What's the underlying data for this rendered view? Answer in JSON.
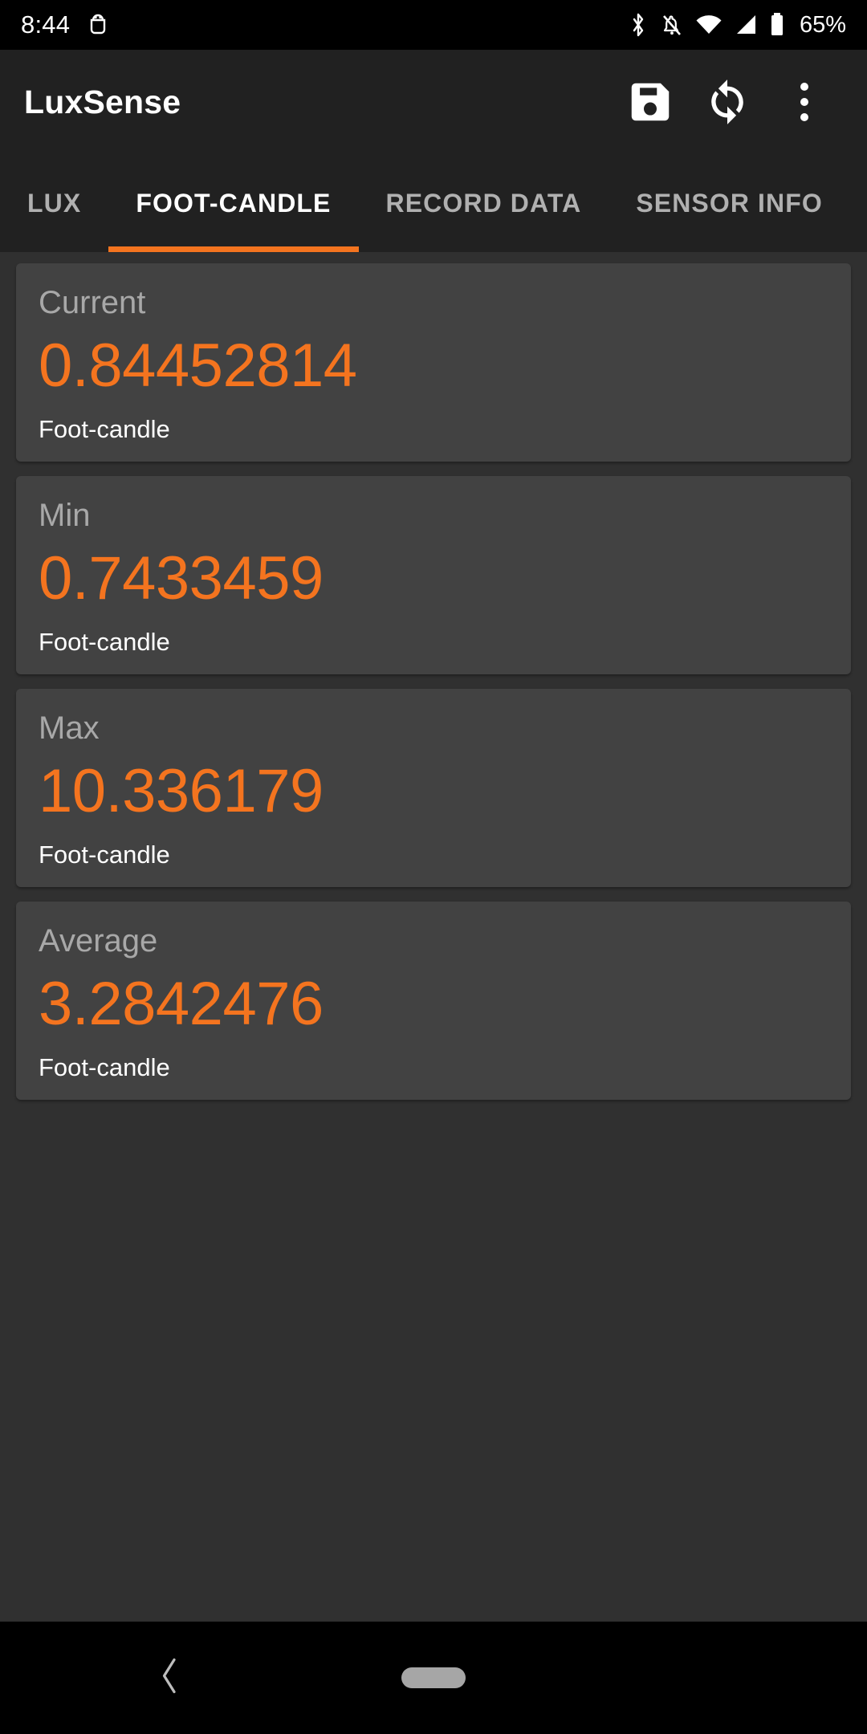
{
  "status_bar": {
    "time": "8:44",
    "battery_percent": "65%",
    "icons": [
      "android-debug-icon",
      "bluetooth-icon",
      "notifications-muted-icon",
      "wifi-icon",
      "cellular-signal-icon",
      "battery-icon"
    ],
    "colors": {
      "background": "#000000",
      "foreground": "#ffffff"
    }
  },
  "app_bar": {
    "title": "LuxSense",
    "actions": [
      {
        "name": "save-button",
        "icon": "save-icon"
      },
      {
        "name": "reset-button",
        "icon": "refresh-icon"
      },
      {
        "name": "overflow-menu-button",
        "icon": "more-vertical-icon"
      }
    ],
    "colors": {
      "background": "#212121",
      "title": "#ffffff"
    }
  },
  "tabs": {
    "items": [
      {
        "label": "LUX",
        "active": false
      },
      {
        "label": "FOOT-CANDLE",
        "active": true
      },
      {
        "label": "RECORD DATA",
        "active": false
      },
      {
        "label": "SENSOR INFO",
        "active": false
      }
    ],
    "active_index": 1,
    "colors": {
      "indicator": "#f4741f",
      "active_text": "#ffffff",
      "inactive_text": "#b0b0b0"
    }
  },
  "cards": [
    {
      "label": "Current",
      "value": "0.84452814",
      "unit": "Foot-candle"
    },
    {
      "label": "Min",
      "value": "0.7433459",
      "unit": "Foot-candle"
    },
    {
      "label": "Max",
      "value": "10.336179",
      "unit": "Foot-candle"
    },
    {
      "label": "Average",
      "value": "3.2842476",
      "unit": "Foot-candle"
    }
  ],
  "theme": {
    "accent": "#f4741f",
    "page_background": "#303030",
    "card_background": "#424242",
    "label_text": "#a8a8a8",
    "unit_text": "#ffffff"
  },
  "nav_bar": {
    "back": "back-chevron-icon",
    "home": "home-pill-icon",
    "background": "#000000"
  }
}
